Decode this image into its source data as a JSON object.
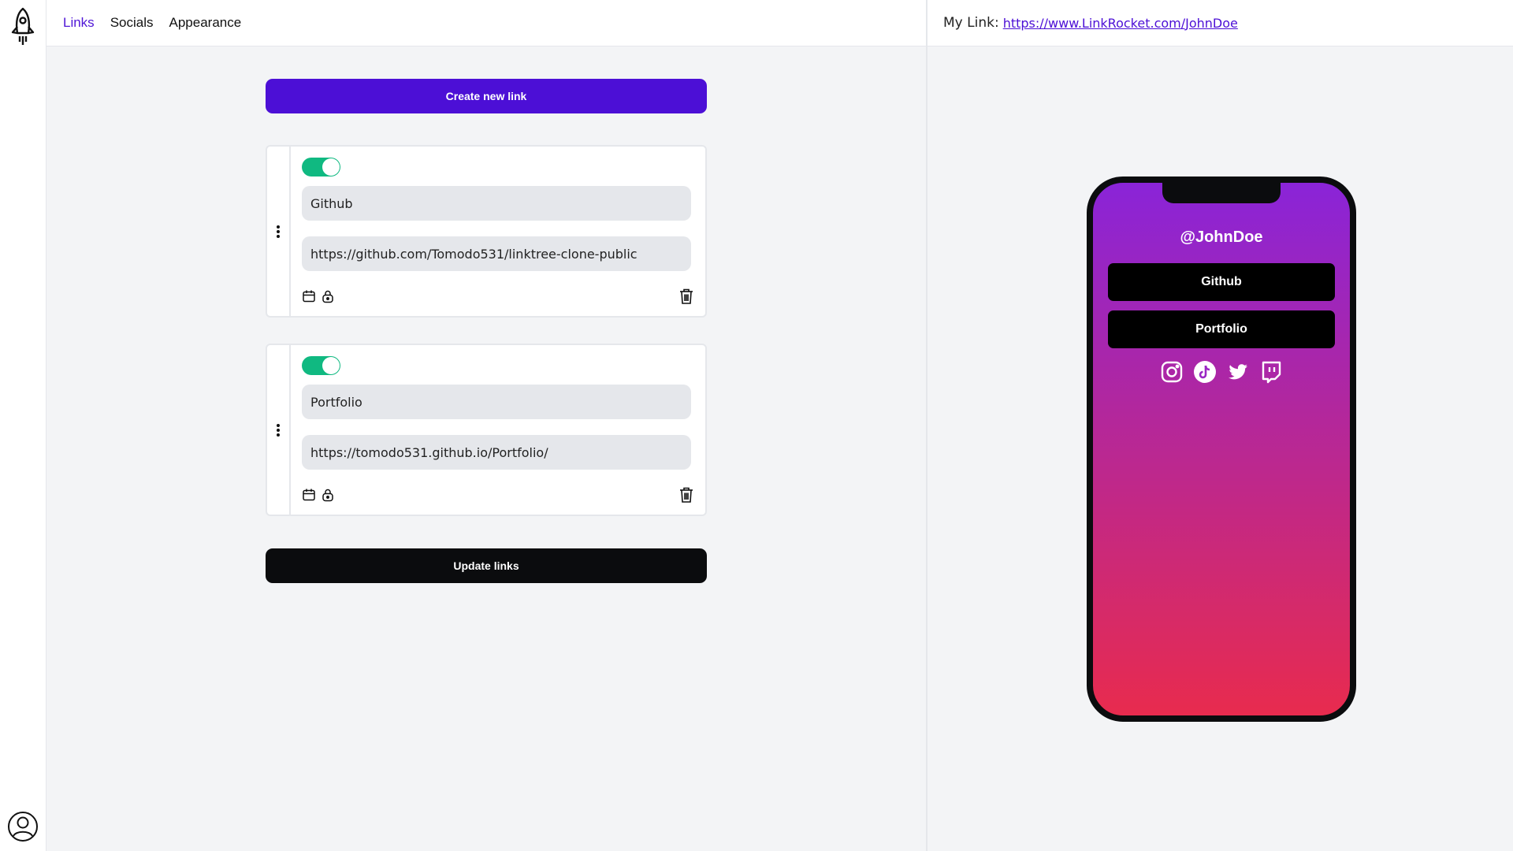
{
  "nav": {
    "tabs": [
      {
        "label": "Links",
        "active": true
      },
      {
        "label": "Socials",
        "active": false
      },
      {
        "label": "Appearance",
        "active": false
      }
    ]
  },
  "editor": {
    "create_label": "Create new link",
    "update_label": "Update links",
    "links": [
      {
        "enabled": true,
        "title": "Github",
        "url": "https://github.com/Tomodo531/linktree-clone-public"
      },
      {
        "enabled": true,
        "title": "Portfolio",
        "url": "https://tomodo531.github.io/Portfolio/"
      }
    ]
  },
  "preview": {
    "label": "My Link:",
    "url": "https://www.LinkRocket.com/JohnDoe",
    "username": "@JohnDoe",
    "buttons": [
      "Github",
      "Portfolio"
    ],
    "social_icons": [
      "instagram-icon",
      "tiktok-icon",
      "twitter-icon",
      "twitch-icon"
    ]
  },
  "colors": {
    "accent": "#4c0fd6",
    "toggle_on": "#10b981",
    "gradient_top": "#8a24d8",
    "gradient_bottom": "#e82b4e"
  }
}
